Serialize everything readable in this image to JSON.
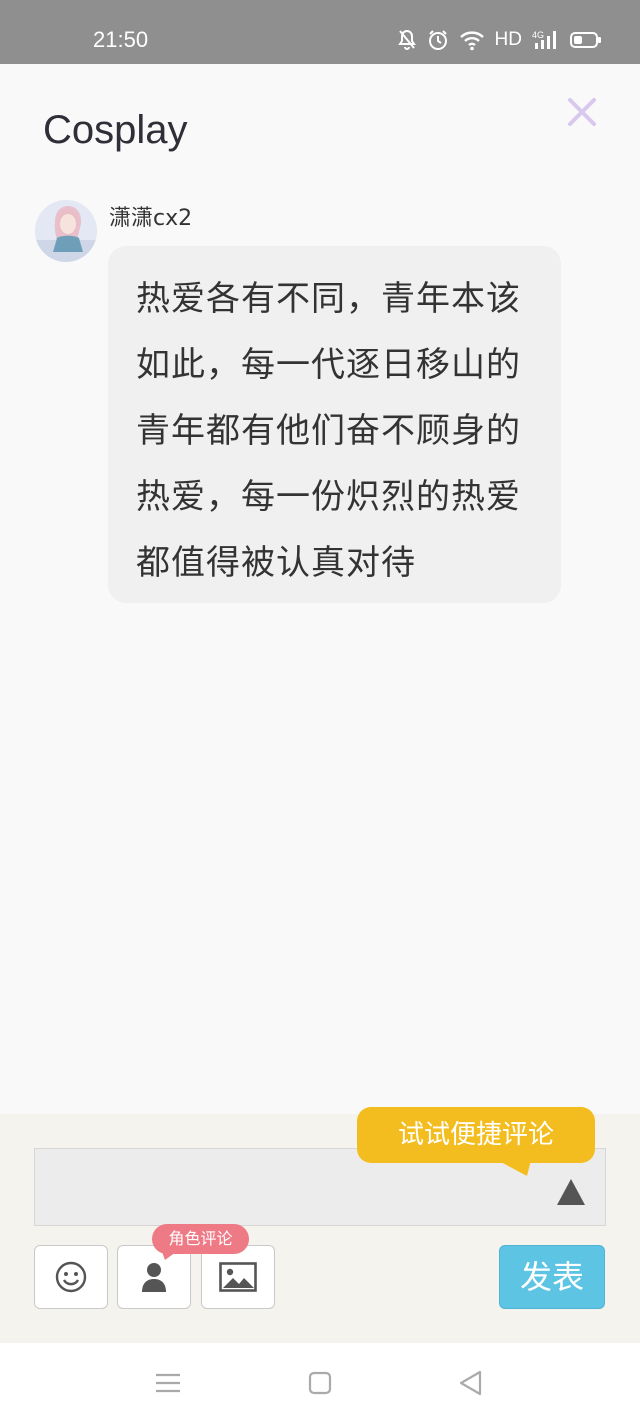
{
  "status_bar": {
    "time": "21:50",
    "icons": [
      "mute-bell-icon",
      "alarm-icon",
      "wifi-icon",
      "hd-label",
      "signal-4g-icon",
      "battery-icon"
    ],
    "hd": "HD"
  },
  "header": {
    "title": "Cosplay",
    "close_icon": "close-icon",
    "close_color": "#d8c8ee"
  },
  "comment": {
    "username": "潇潇cx2",
    "text": "热爱各有不同，青年本该如此，每一代逐日移山的青年都有他们奋不顾身的热爱，每一份炽烈的热爱都值得被认真对待"
  },
  "composer": {
    "input_value": "",
    "tip": "试试便捷评论",
    "role_badge": "角色评论",
    "tools": [
      "emoji-icon",
      "person-icon",
      "image-icon"
    ],
    "send_label": "发表"
  },
  "colors": {
    "tip": "#f4bd1f",
    "send": "#5ec4e4",
    "role_badge": "#ee7a86"
  },
  "navbar": {
    "items": [
      "menu-icon",
      "home-square-icon",
      "back-triangle-icon"
    ]
  }
}
